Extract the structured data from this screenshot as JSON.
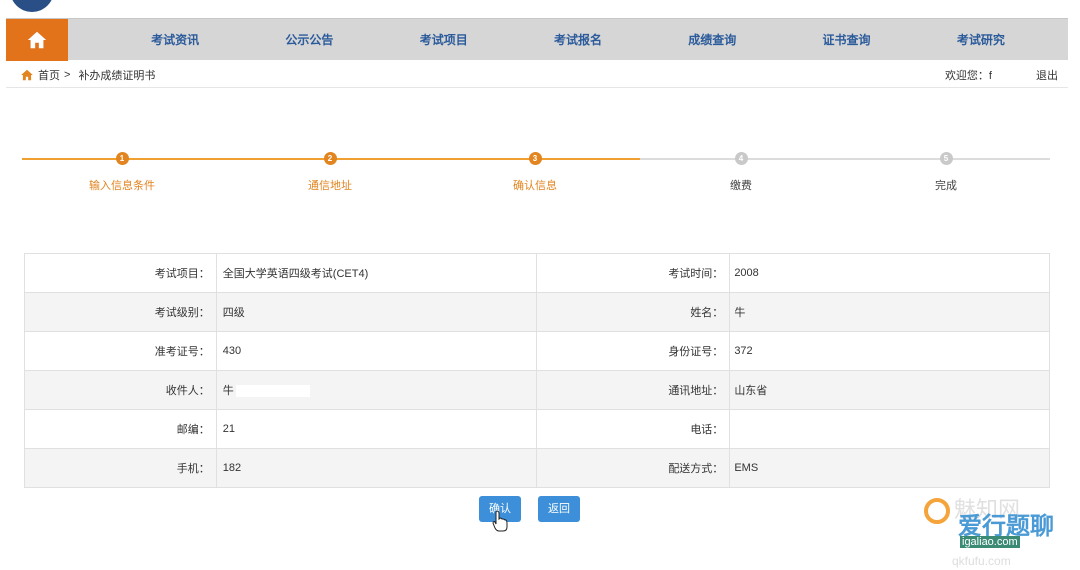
{
  "nav": {
    "home_icon": "home-icon",
    "items": [
      "考试资讯",
      "公示公告",
      "考试项目",
      "考试报名",
      "成绩查询",
      "证书查询",
      "考试研究"
    ]
  },
  "breadcrumb": {
    "home": "首页",
    "separator": ">",
    "current": "补办成绩证明书",
    "welcome": "欢迎您：f",
    "logout": "退出"
  },
  "steps": [
    {
      "number": "1",
      "label": "输入信息条件",
      "status": "done"
    },
    {
      "number": "2",
      "label": "通信地址",
      "status": "done"
    },
    {
      "number": "3",
      "label": "确认信息",
      "status": "done"
    },
    {
      "number": "4",
      "label": "缴费",
      "status": "todo"
    },
    {
      "number": "5",
      "label": "完成",
      "status": "todo"
    }
  ],
  "info": {
    "rows": [
      {
        "label1": "考试项目：",
        "value1": "全国大学英语四级考试(CET4)",
        "label2": "考试时间：",
        "value2": "2008"
      },
      {
        "label1": "考试级别：",
        "value1": "四级",
        "label2": "姓名：",
        "value2": "牛"
      },
      {
        "label1": "准考证号：",
        "value1": "430",
        "label2": "身份证号：",
        "value2": "372"
      },
      {
        "label1": "收件人：",
        "value1": "牛",
        "label2": "通讯地址：",
        "value2": "山东省"
      },
      {
        "label1": "邮编：",
        "value1": "21",
        "label2": "电话：",
        "value2": ""
      },
      {
        "label1": "手机：",
        "value1": "182",
        "label2": "配送方式：",
        "value2": "EMS"
      }
    ]
  },
  "buttons": {
    "confirm": "确认",
    "back": "返回"
  },
  "watermark": {
    "line1": "魅知网",
    "line2": "爱行题聊",
    "line3": "igaliao.com",
    "line4": "qkfufu.com"
  },
  "colors": {
    "accent_orange": "#e2731b",
    "nav_text": "#2b5b9b",
    "button_blue": "#3c8fd8"
  }
}
